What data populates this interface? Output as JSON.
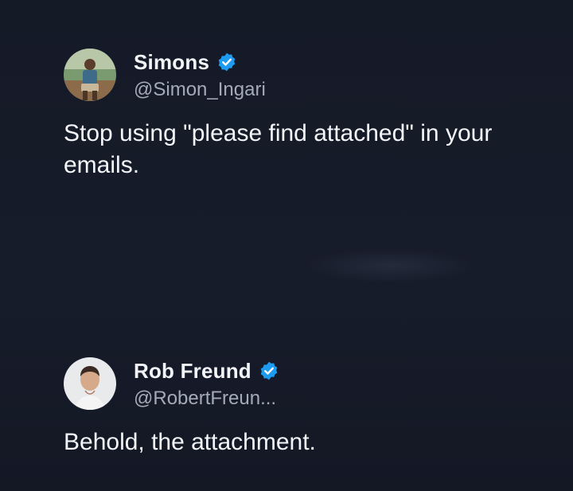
{
  "tweets": [
    {
      "author": {
        "name": "Simons",
        "handle": "@Simon_Ingari",
        "verified": true
      },
      "text": "Stop using \"please find attached\" in your emails."
    },
    {
      "author": {
        "name": "Rob Freund",
        "handle": "@RobertFreun...",
        "verified": true
      },
      "text": "Behold, the attachment."
    }
  ],
  "colors": {
    "background": "#161b28",
    "name": "#f2f4f7",
    "handle": "#a4abb8",
    "verified_badge": "#1d9bf0"
  },
  "icons": {
    "verified": "verified-badge-icon"
  }
}
